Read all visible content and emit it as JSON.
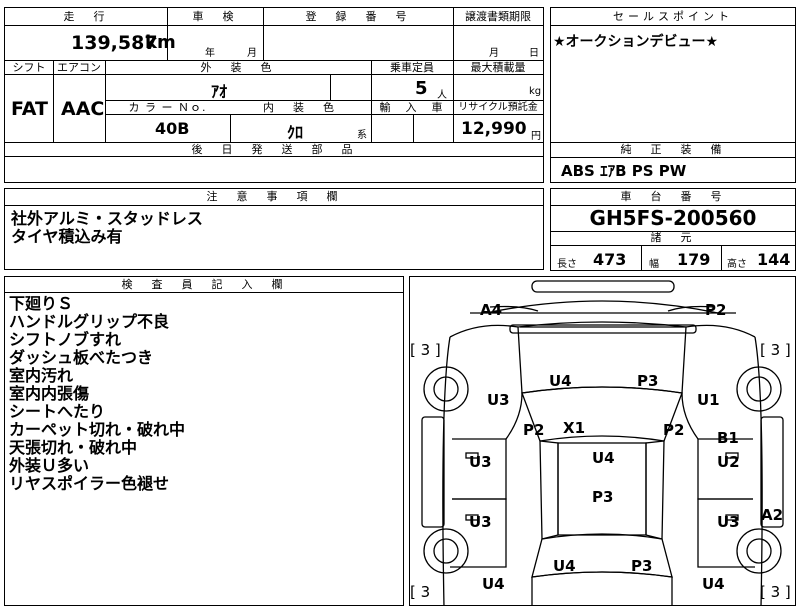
{
  "grid": {
    "top_row": {
      "mileage_label": "走　行",
      "mileage_value": "139,587",
      "mileage_unit": "km",
      "inspection_label": "車　検",
      "year_unit": "年",
      "month_unit": "月",
      "registration_label": "登　録　番　号",
      "transfer_label": "譲渡書類期限",
      "transfer_month": "月",
      "transfer_day": "日"
    },
    "second_row": {
      "shift_label": "シフト",
      "ac_label": "エアコン",
      "shift_value": "FAT",
      "ac_value": "AAC",
      "exterior_label": "外　装　色",
      "exterior_value": "ｱｵ",
      "capacity_label": "乗車定員",
      "capacity_value": "5",
      "capacity_unit": "人",
      "load_label": "最大積載量",
      "load_unit": "kg",
      "color_no_label": "カ ラ ー Ｎｏ.",
      "color_no_value": "40B",
      "interior_label": "内　装　色",
      "interior_value": "ｸﾛ",
      "interior_suffix": "系",
      "import_label": "輸　入　車",
      "recycle_label": "リサイクル預託金",
      "recycle_value": "12,990",
      "recycle_unit": "円"
    },
    "later_parts_label": "後　日　発　送　部　品"
  },
  "sales_point": {
    "label": "セールスポイント",
    "text": "★オークションデビュー★"
  },
  "equipment": {
    "label": "純　正　装　備",
    "text": "ABS ｴｱB PS PW"
  },
  "notes": {
    "label": "注　意　事　項　欄",
    "lines": [
      "社外アルミ・スタッドレス",
      "タイヤ積込み有"
    ]
  },
  "chassis": {
    "label": "車　台　番　号",
    "value": "GH5FS-200560"
  },
  "specs": {
    "label": "諸　元",
    "length_label": "長さ",
    "length_value": "473",
    "width_label": "幅",
    "width_value": "179",
    "height_label": "高さ",
    "height_value": "144"
  },
  "inspector": {
    "label": "検　査　員　記　入　欄",
    "lines": [
      "下廻りＳ",
      "ハンドルグリップ不良",
      "シフトノブすれ",
      "ダッシュ板べたつき",
      "室内汚れ",
      "室内内張傷",
      "シートへたり",
      "カーペット切れ・破れ中",
      "天張切れ・破れ中",
      "外装Ｕ多い",
      "リヤスポイラー色褪せ"
    ]
  },
  "damage_map": {
    "tire_marks": [
      "[ 3 ]",
      "[ 3 ]",
      "[ 3",
      "[ 3 ]"
    ],
    "codes": [
      "A4",
      "P2",
      "U4",
      "P3",
      "U3",
      "U1",
      "P2",
      "X1",
      "P2",
      "B1",
      "U3",
      "U4",
      "U2",
      "P3",
      "U3",
      "U3",
      "A2",
      "U4",
      "P3",
      "U4",
      "U4"
    ]
  }
}
